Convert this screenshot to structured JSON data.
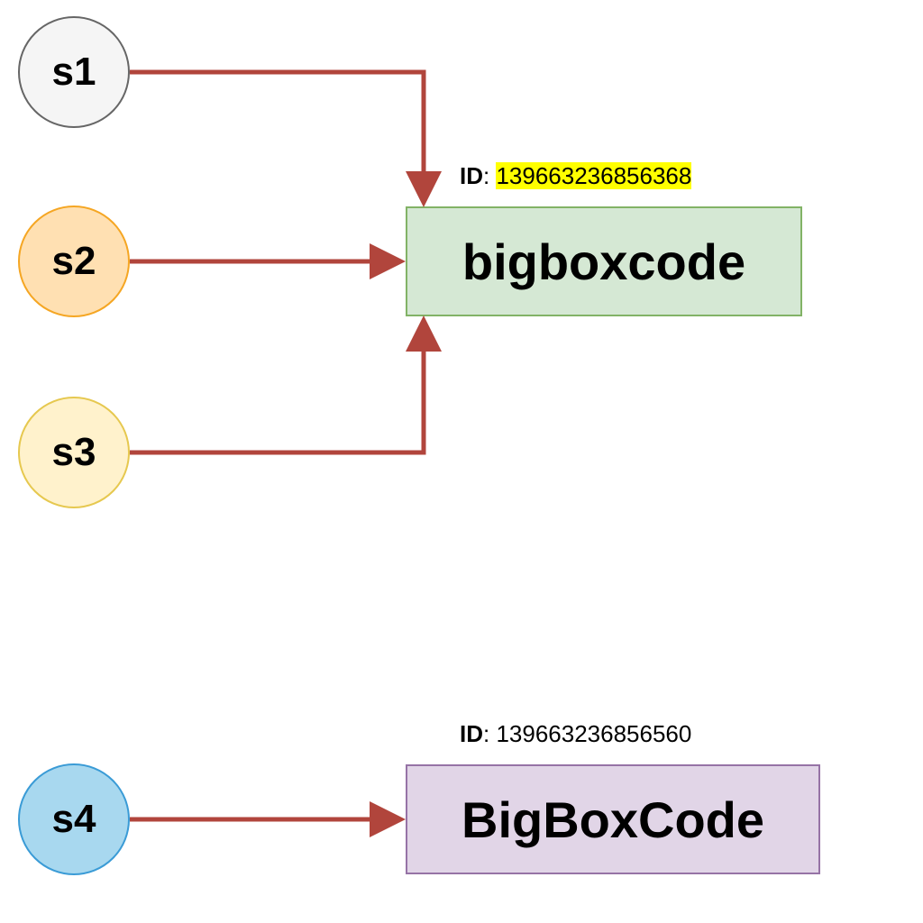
{
  "nodes": {
    "s1": {
      "label": "s1",
      "fill": "#f5f5f5",
      "stroke": "#666666"
    },
    "s2": {
      "label": "s2",
      "fill": "#ffe0b2",
      "stroke": "#f5a623"
    },
    "s3": {
      "label": "s3",
      "fill": "#fff2cc",
      "stroke": "#e6c84f"
    },
    "s4": {
      "label": "s4",
      "fill": "#a8d8ef",
      "stroke": "#3a9bd6"
    }
  },
  "targets": {
    "box1": {
      "label": "bigboxcode",
      "fill": "#d5e8d4",
      "stroke": "#82b366"
    },
    "box2": {
      "label": "BigBoxCode",
      "fill": "#e1d5e7",
      "stroke": "#9673a6"
    }
  },
  "ids": {
    "box1": {
      "key": "ID",
      "value": "139663236856368",
      "highlight": true
    },
    "box2": {
      "key": "ID",
      "value": "139663236856560",
      "highlight": false
    }
  },
  "arrowColor": "#b1453c"
}
